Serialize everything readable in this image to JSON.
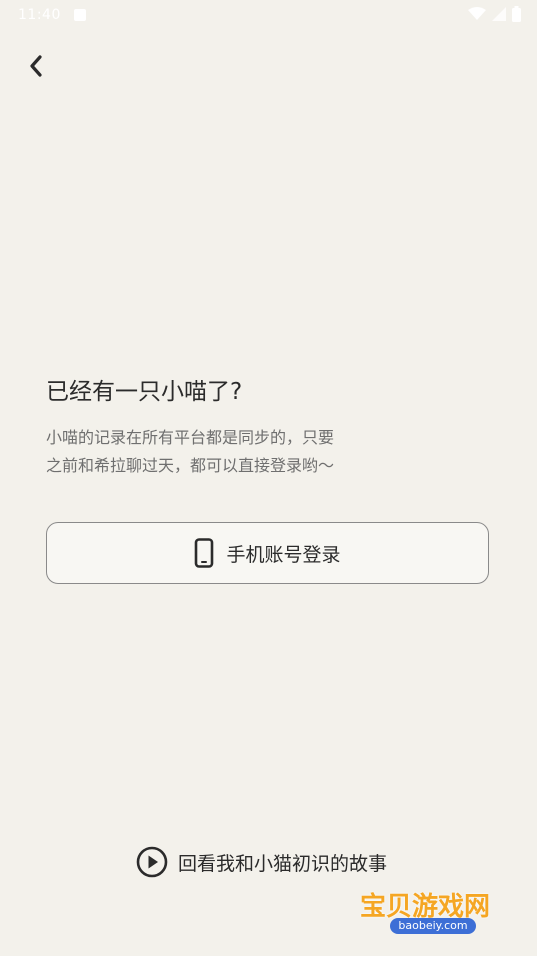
{
  "status_bar": {
    "time": "11:40"
  },
  "header": {
    "back_icon": "chevron-left-icon"
  },
  "main": {
    "title": "已经有一只小喵了?",
    "description_lines": [
      "小喵的记录在所有平台都是同步的，只要",
      "之前和希拉聊过天，都可以直接登录哟～"
    ],
    "login_button": {
      "icon": "phone-icon",
      "label": "手机账号登录"
    },
    "replay_link": {
      "icon": "play-circle-icon",
      "label": "回看我和小猫初识的故事"
    }
  },
  "watermark": {
    "text": "宝贝游戏网",
    "url": "baobeiy.com"
  }
}
